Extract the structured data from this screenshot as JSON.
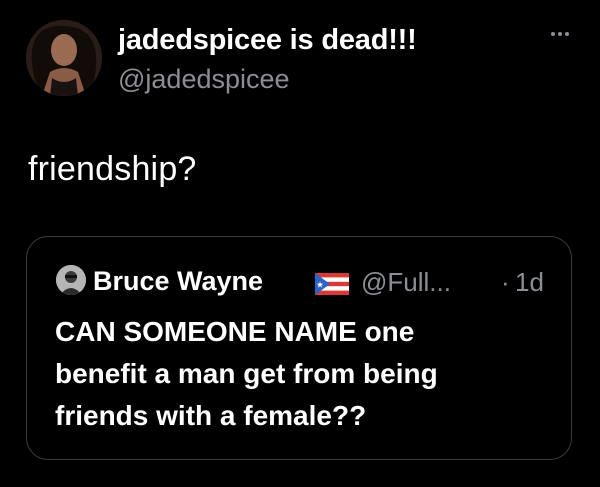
{
  "tweet": {
    "author": {
      "display_name": "jadedspicee is dead!!!",
      "handle": "@jadedspicee",
      "avatar_icon": "profile-photo"
    },
    "more_icon": "ellipsis-icon",
    "text": "friendship?",
    "quoted_tweet": {
      "author": {
        "display_name": "Bruce Wayne",
        "flag_icon": "puerto-rico-flag",
        "handle": "@Full...",
        "separator": "·",
        "timestamp": "1d"
      },
      "text_lines": [
        "CAN SOMEONE NAME one",
        "benefit a man get from being",
        "friends with a female??"
      ]
    }
  },
  "colors": {
    "background": "#000000",
    "primary_text": "#ffffff",
    "secondary_text": "#8b8f93",
    "border": "#3a3d41"
  }
}
